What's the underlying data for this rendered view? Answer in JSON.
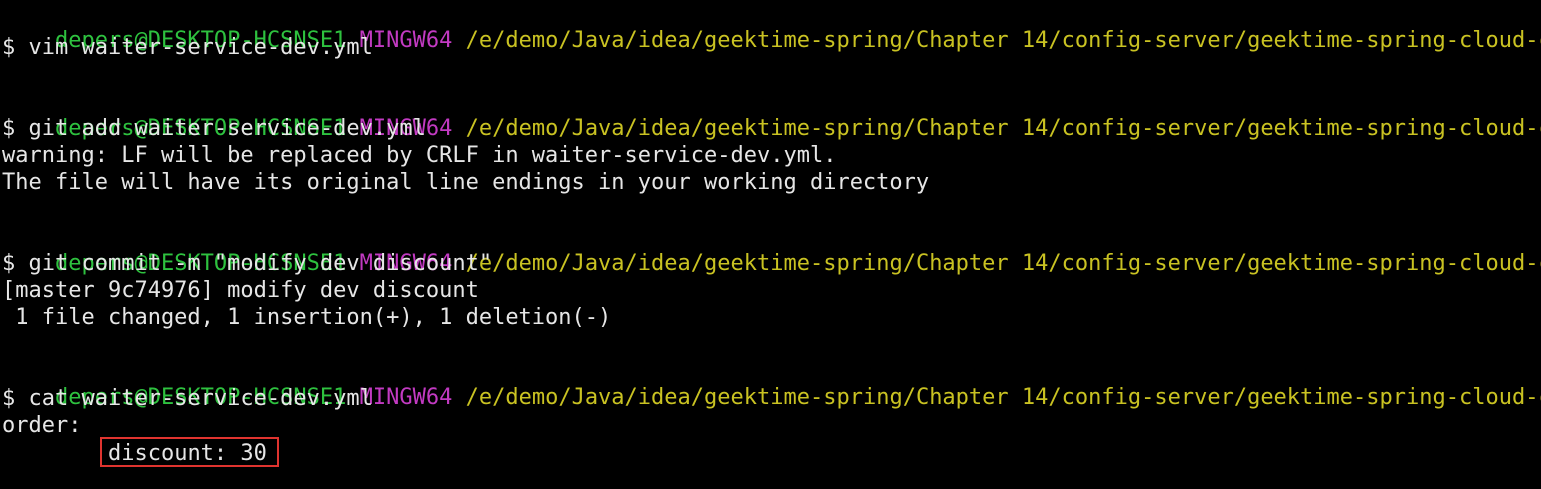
{
  "colors": {
    "background": "#000000",
    "text": "#e6e6e6",
    "user_host": "#2ec23f",
    "system": "#c23ac2",
    "path": "#c9c222",
    "highlight_border": "#e0342f"
  },
  "prompts": [
    {
      "user_host": "depers@DESKTOP-HCSNSE1",
      "system": "MINGW64",
      "path": "/e/demo/Java/idea/geektime-spring/Chapter 14/config-server/geektime-spring-cloud-config-"
    },
    {
      "user_host": "depers@DESKTOP-HCSNSE1",
      "system": "MINGW64",
      "path": "/e/demo/Java/idea/geektime-spring/Chapter 14/config-server/geektime-spring-cloud-config-"
    },
    {
      "user_host": "depers@DESKTOP-HCSNSE1",
      "system": "MINGW64",
      "path": "/e/demo/Java/idea/geektime-spring/Chapter 14/config-server/geektime-spring-cloud-config-"
    },
    {
      "user_host": "depers@DESKTOP-HCSNSE1",
      "system": "MINGW64",
      "path": "/e/demo/Java/idea/geektime-spring/Chapter 14/config-server/geektime-spring-cloud-config-"
    }
  ],
  "commands": [
    "$ vim waiter-service-dev.yml",
    "$ git add waiter-service-dev.yml",
    "$ git commit -m \"modify dev discount\"",
    "$ cat waiter-service-dev.yml"
  ],
  "output": {
    "git_add_warning_1": "warning: LF will be replaced by CRLF in waiter-service-dev.yml.",
    "git_add_warning_2": "The file will have its original line endings in your working directory",
    "commit_result": "[master 9c74976] modify dev discount",
    "commit_stats": " 1 file changed, 1 insertion(+), 1 deletion(-)",
    "cat_line_1": "order:",
    "cat_line_2_indent": "        ",
    "cat_line_2": "discount: 30"
  }
}
